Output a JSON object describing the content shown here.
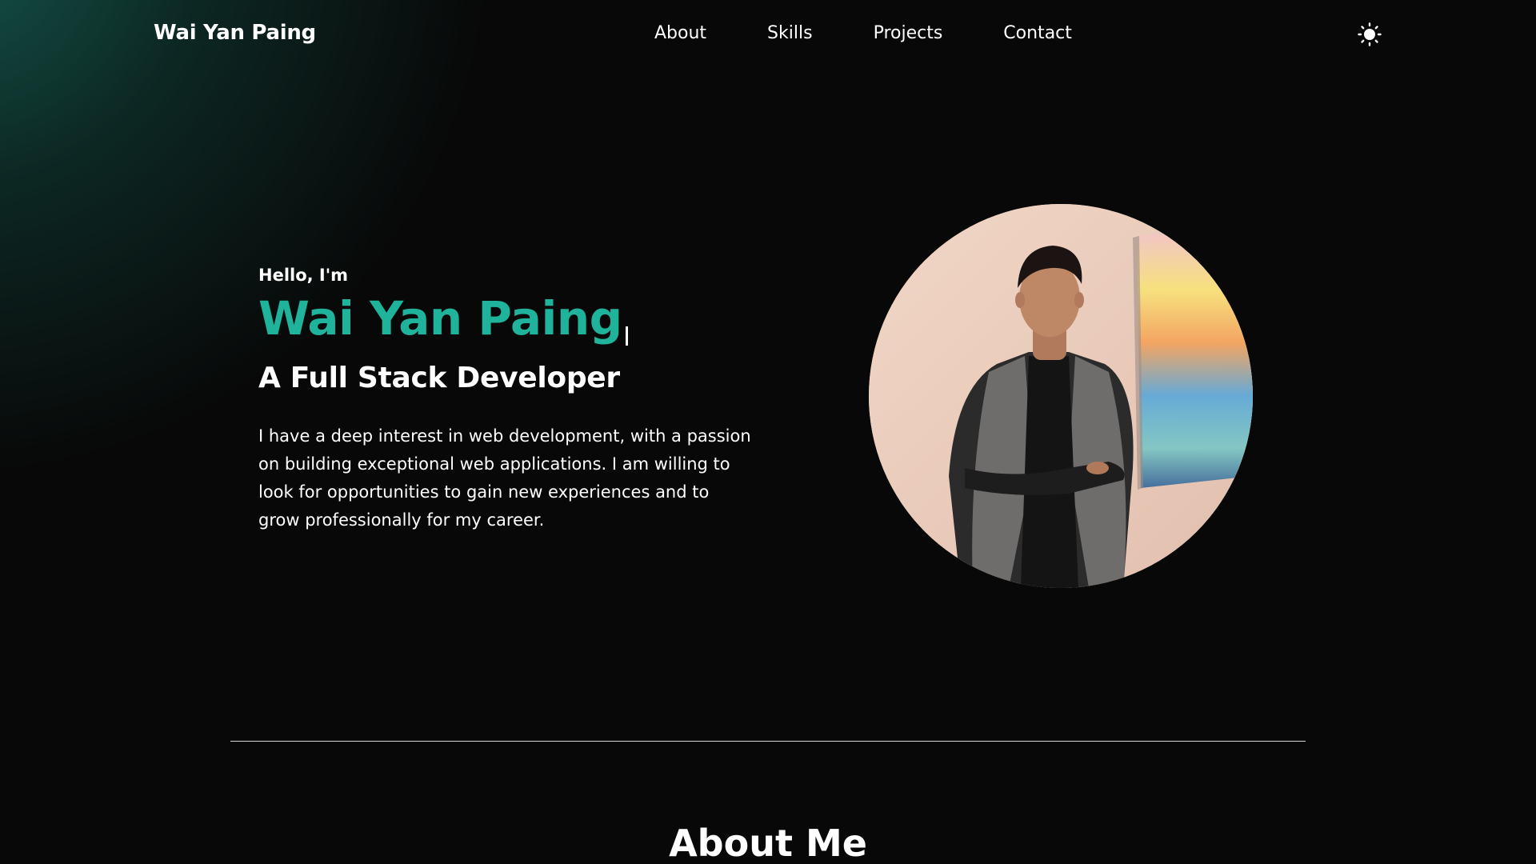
{
  "nav": {
    "brand": "Wai Yan Paing",
    "links": [
      {
        "label": "About"
      },
      {
        "label": "Skills"
      },
      {
        "label": "Projects"
      },
      {
        "label": "Contact"
      }
    ],
    "theme_toggle_icon": "sun-icon"
  },
  "hero": {
    "greeting": "Hello, I'm",
    "name": "Wai Yan Paing",
    "role": "A Full Stack Developer",
    "bio": "I have a deep interest in web development, with a passion on building exceptional web applications. I am willing to look for opportunities to gain new experiences and to grow professionally for my career."
  },
  "about": {
    "heading": "About Me"
  },
  "colors": {
    "accent": "#1fb39c",
    "background": "#080808",
    "glow": "#155a4e"
  }
}
